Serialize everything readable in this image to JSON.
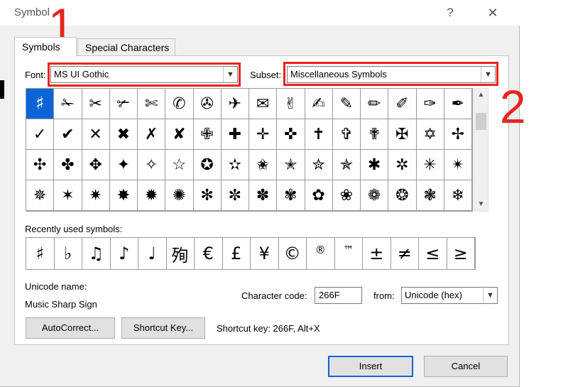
{
  "dialog": {
    "title": "Symbol",
    "help_label": "?",
    "close_label": "✕"
  },
  "tabs": [
    {
      "label": "Symbols",
      "active": true
    },
    {
      "label": "Special Characters",
      "active": false
    }
  ],
  "font": {
    "label": "Font:",
    "value": "MS UI Gothic"
  },
  "subset": {
    "label": "Subset:",
    "value": "Miscellaneous Symbols"
  },
  "annotations": [
    "1",
    "2"
  ],
  "symbol_grid": {
    "rows": [
      [
        "♯",
        "✁",
        "✂",
        "✃",
        "✄",
        "✆",
        "✇",
        "✈",
        "✉",
        "✌",
        "✍",
        "✎",
        "✏",
        "✐",
        "✑",
        "✒"
      ],
      [
        "✓",
        "✔",
        "✕",
        "✖",
        "✗",
        "✘",
        "✙",
        "✚",
        "✛",
        "✜",
        "✝",
        "✞",
        "✟",
        "✠",
        "✡",
        "✢"
      ],
      [
        "✣",
        "✤",
        "✥",
        "✦",
        "✧",
        "☆",
        "✪",
        "✫",
        "✬",
        "✭",
        "✮",
        "✯",
        "✱",
        "✲",
        "✳",
        "✴"
      ],
      [
        "✵",
        "✶",
        "✷",
        "✸",
        "✹",
        "✺",
        "✻",
        "✼",
        "✽",
        "✾",
        "✿",
        "❀",
        "❁",
        "❂",
        "❃",
        "❄"
      ]
    ],
    "selected": "♯"
  },
  "recent": {
    "label": "Recently used symbols:",
    "symbols": [
      "♯",
      "♭",
      "♫",
      "♪",
      "♩",
      "殉",
      "€",
      "£",
      "¥",
      "©",
      "®",
      "™",
      "±",
      "≠",
      "≤",
      "≥"
    ]
  },
  "unicode_name": {
    "label": "Unicode name:",
    "value": "Music Sharp Sign"
  },
  "character_code": {
    "label": "Character code:",
    "value": "266F"
  },
  "from": {
    "label": "from:",
    "value": "Unicode (hex)"
  },
  "buttons": {
    "autocorrect": "AutoCorrect...",
    "shortcut_key": "Shortcut Key...",
    "insert": "Insert",
    "cancel": "Cancel"
  },
  "shortcut_text": "Shortcut key: 266F, Alt+X",
  "colors": {
    "accent": "#0a64d6",
    "annotation_red": "#e8231f"
  }
}
